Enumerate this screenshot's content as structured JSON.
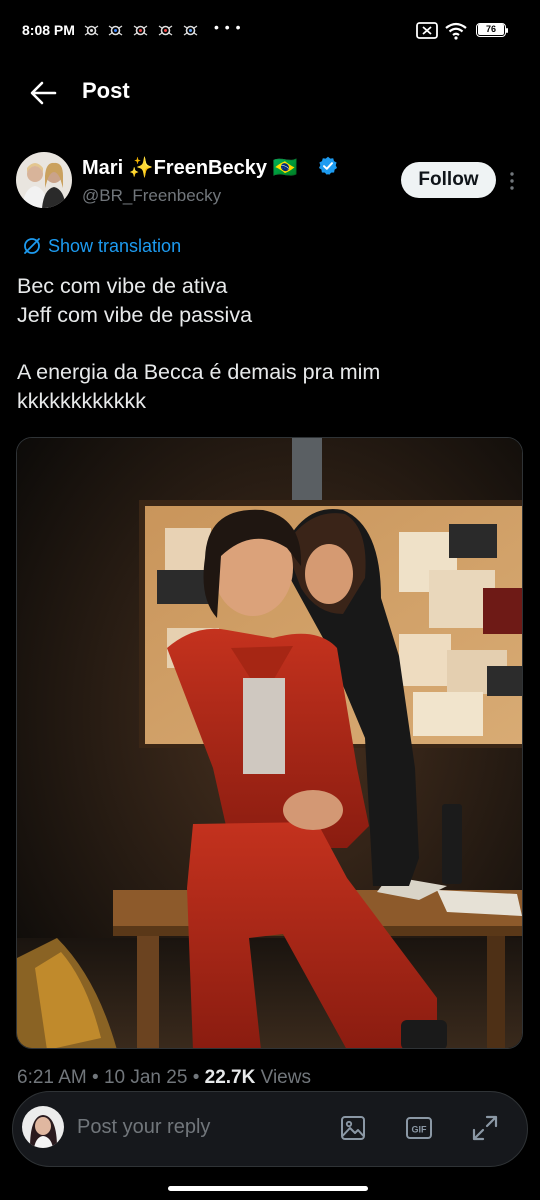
{
  "status_bar": {
    "time": "8:08 PM",
    "more": "• • •",
    "battery": "76"
  },
  "header": {
    "title": "Post"
  },
  "author": {
    "name": "Mari ✨FreenBecky 🇧🇷",
    "handle": "@BR_Freenbecky",
    "follow_label": "Follow"
  },
  "translation": {
    "label": "Show translation"
  },
  "tweet": {
    "lines": [
      "Bec com vibe de ativa",
      "Jeff com vibe de passiva",
      "A energia da Becca é demais pra mim",
      "kkkkkkkkkkkk"
    ]
  },
  "meta": {
    "time": "6:21 AM",
    "date": "10 Jan 25",
    "views_count": "22.7K",
    "views_label": "Views"
  },
  "reply": {
    "placeholder": "Post your reply"
  },
  "icons": {
    "back": "arrow-left-icon",
    "verified": "verified-badge-icon",
    "more": "more-vertical-icon",
    "translate": "translate-icon",
    "image": "image-icon",
    "gif": "gif-icon",
    "expand": "expand-icon"
  },
  "colors": {
    "background": "#000000",
    "link": "#1d9bf0",
    "muted": "#71767b",
    "text": "#e7e9ea",
    "follow_bg": "#eff3f4"
  }
}
